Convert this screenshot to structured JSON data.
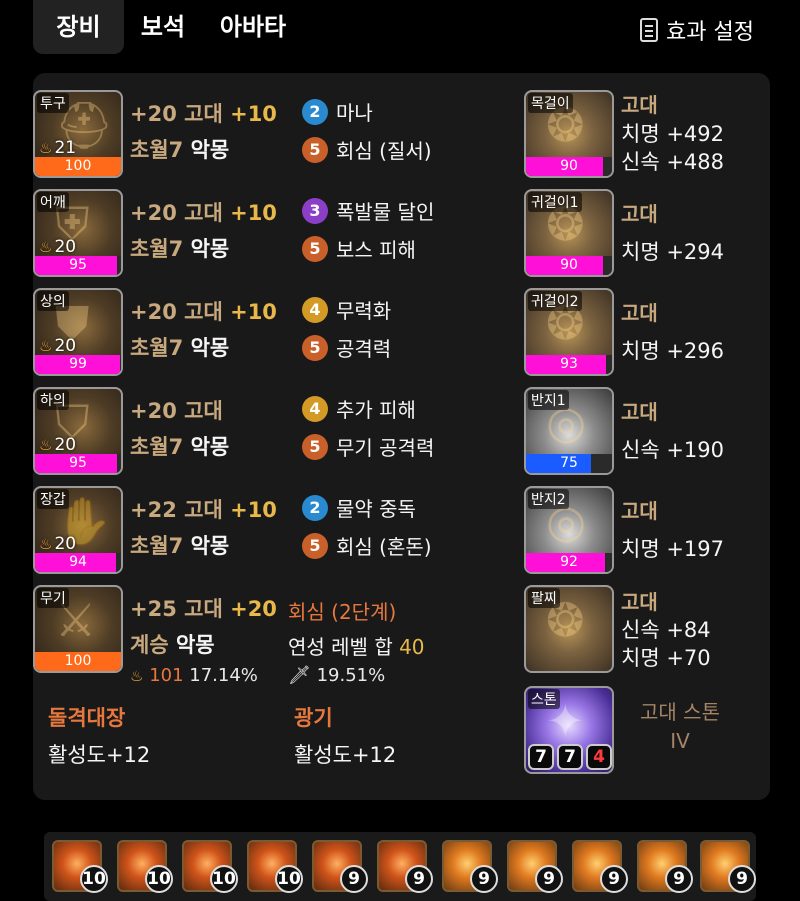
{
  "tabs": [
    {
      "label": "장비",
      "active": true
    },
    {
      "label": "보석",
      "active": false
    },
    {
      "label": "아바타",
      "active": false
    }
  ],
  "settings_label": "효과 설정",
  "equipment": [
    {
      "slot": "투구",
      "tier": "21",
      "quality": 100,
      "quality_color": "#ff6a1a",
      "line1_a": "+20 고대",
      "line1_b": "+10",
      "line2_a": "초월7",
      "line2_b": "악몽",
      "engravings": [
        {
          "level": "2",
          "name": "마나",
          "color": "blue"
        },
        {
          "level": "5",
          "name": "회심 (질서)",
          "color": "orange"
        }
      ]
    },
    {
      "slot": "어깨",
      "tier": "20",
      "quality": 95,
      "quality_color": "#ff10d8",
      "line1_a": "+20 고대",
      "line1_b": "+10",
      "line2_a": "초월7",
      "line2_b": "악몽",
      "engravings": [
        {
          "level": "3",
          "name": "폭발물 달인",
          "color": "purple"
        },
        {
          "level": "5",
          "name": "보스 피해",
          "color": "orange"
        }
      ]
    },
    {
      "slot": "상의",
      "tier": "20",
      "quality": 99,
      "quality_color": "#ff10d8",
      "line1_a": "+20 고대",
      "line1_b": "+10",
      "line2_a": "초월7",
      "line2_b": "악몽",
      "engravings": [
        {
          "level": "4",
          "name": "무력화",
          "color": "gold"
        },
        {
          "level": "5",
          "name": "공격력",
          "color": "orange"
        }
      ]
    },
    {
      "slot": "하의",
      "tier": "20",
      "quality": 95,
      "quality_color": "#ff10d8",
      "line1_a": "+20 고대",
      "line1_b": "",
      "line2_a": "초월7",
      "line2_b": "악몽",
      "engravings": [
        {
          "level": "4",
          "name": "추가 피해",
          "color": "gold"
        },
        {
          "level": "5",
          "name": "무기 공격력",
          "color": "orange"
        }
      ]
    },
    {
      "slot": "장갑",
      "tier": "20",
      "quality": 94,
      "quality_color": "#ff10d8",
      "line1_a": "+22 고대",
      "line1_b": "+10",
      "line2_a": "초월7",
      "line2_b": "악몽",
      "engravings": [
        {
          "level": "2",
          "name": "물약 중독",
          "color": "blue"
        },
        {
          "level": "5",
          "name": "회심 (혼돈)",
          "color": "orange"
        }
      ]
    }
  ],
  "weapon": {
    "slot": "무기",
    "quality": 100,
    "quality_color": "#ff6a1a",
    "line1_a": "+25 고대",
    "line1_b": "+20",
    "line2_a": "계승",
    "line2_b": "악몽",
    "tier": "101",
    "tier_pct": "17.14%",
    "effect": "회심 (2단계)",
    "sum_label": "연성 레벨 합",
    "sum_value": "40",
    "elixir_pct": "19.51%"
  },
  "sets": [
    {
      "title": "돌격대장",
      "value": "활성도+12"
    },
    {
      "title": "광기",
      "value": "활성도+12"
    }
  ],
  "accessories": [
    {
      "slot": "목걸이",
      "grade": "고대",
      "quality": 90,
      "quality_color": "#ff10d8",
      "stats": [
        "치명 +492",
        "신속 +488"
      ],
      "type": "acc"
    },
    {
      "slot": "귀걸이1",
      "grade": "고대",
      "quality": 90,
      "quality_color": "#ff10d8",
      "stats": [
        "치명 +294"
      ],
      "type": "acc"
    },
    {
      "slot": "귀걸이2",
      "grade": "고대",
      "quality": 93,
      "quality_color": "#ff10d8",
      "stats": [
        "치명 +296"
      ],
      "type": "acc"
    },
    {
      "slot": "반지1",
      "grade": "고대",
      "quality": 75,
      "quality_color": "#1a5cff",
      "stats": [
        "신속 +190"
      ],
      "type": "ring"
    },
    {
      "slot": "반지2",
      "grade": "고대",
      "quality": 92,
      "quality_color": "#ff10d8",
      "stats": [
        "치명 +197"
      ],
      "type": "ring"
    },
    {
      "slot": "팔찌",
      "grade": "고대",
      "quality": null,
      "quality_color": "",
      "stats": [
        "신속 +84",
        "치명 +70"
      ],
      "type": "acc"
    }
  ],
  "stone": {
    "slot": "스톤",
    "title": "고대 스톤",
    "numeral": "IV",
    "levels": [
      "7",
      "7",
      "4"
    ]
  },
  "gems": [
    {
      "level": "10",
      "kind": "fire"
    },
    {
      "level": "10",
      "kind": "fire"
    },
    {
      "level": "10",
      "kind": "fire"
    },
    {
      "level": "10",
      "kind": "fire"
    },
    {
      "level": "9",
      "kind": "fire"
    },
    {
      "level": "9",
      "kind": "fire"
    },
    {
      "level": "9",
      "kind": "ruby"
    },
    {
      "level": "9",
      "kind": "ruby"
    },
    {
      "level": "9",
      "kind": "ruby"
    },
    {
      "level": "9",
      "kind": "ruby"
    },
    {
      "level": "9",
      "kind": "ruby"
    }
  ],
  "colors": {
    "tan": "#c8a87e",
    "gold": "#e8b84a",
    "orange": "#e6783e",
    "pink": "#ff10d8",
    "blue": "#1a5cff"
  }
}
